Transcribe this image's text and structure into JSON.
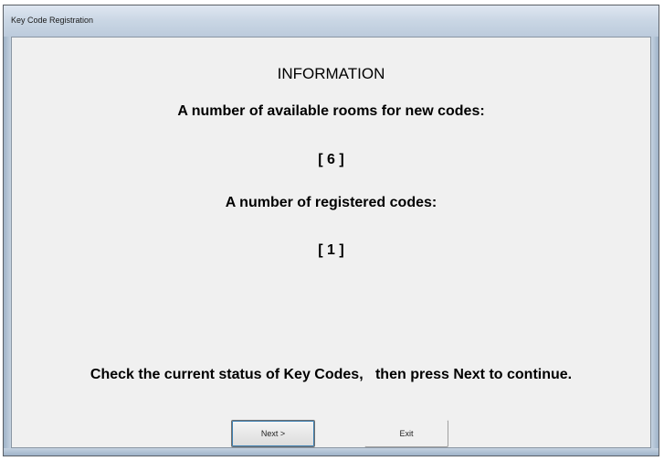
{
  "window": {
    "title": "Key Code Registration"
  },
  "content": {
    "heading": "INFORMATION",
    "available_label": "A number of available rooms for new codes:",
    "available_value": "[ 6 ]",
    "registered_label": "A number of registered codes:",
    "registered_value": "[ 1 ]",
    "instruction": "Check the current status of Key Codes,   then press Next to continue."
  },
  "buttons": {
    "next_label": "Next >",
    "exit_label": "Exit"
  }
}
